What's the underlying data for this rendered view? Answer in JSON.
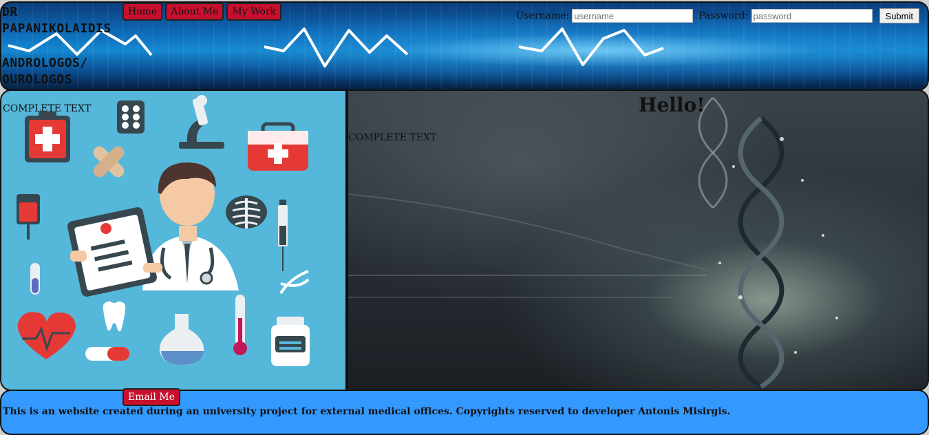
{
  "header": {
    "brand_lines": [
      "DR",
      "PAPANIKOLAIDIS",
      "ANDROLOGOS/",
      "OUROLOGOS"
    ],
    "nav": {
      "home": "Home",
      "about": "About Me",
      "work": "My Work"
    },
    "login": {
      "username_label": "Username:",
      "username_placeholder": "username",
      "password_label": "Password:",
      "password_placeholder": "password",
      "submit": "Submit"
    }
  },
  "main": {
    "left_text": "COMPLETE TEXT",
    "hello": "Hello!",
    "right_text": "COMPLETE TEXT"
  },
  "footer": {
    "email_button": "Email Me",
    "text": "This is an website created during an university project for external medical offices. Copyrights reserved to developer Antonis Misirgis."
  },
  "colors": {
    "nav_button": "#c8102e",
    "footer_bg": "#3399ff",
    "left_panel_bg": "#55b7d9"
  },
  "icons": [
    "heartbeat-line-icon",
    "clipboard-icon",
    "pill-pack-icon",
    "microscope-icon",
    "first-aid-kit-icon",
    "bandage-icon",
    "doctor-icon",
    "iv-bag-icon",
    "ribcage-icon",
    "syringe-icon",
    "test-tube-icon",
    "dna-icon",
    "heart-icon",
    "tooth-icon",
    "capsule-icon",
    "flask-icon",
    "thermometer-icon",
    "medicine-bottle-icon"
  ]
}
